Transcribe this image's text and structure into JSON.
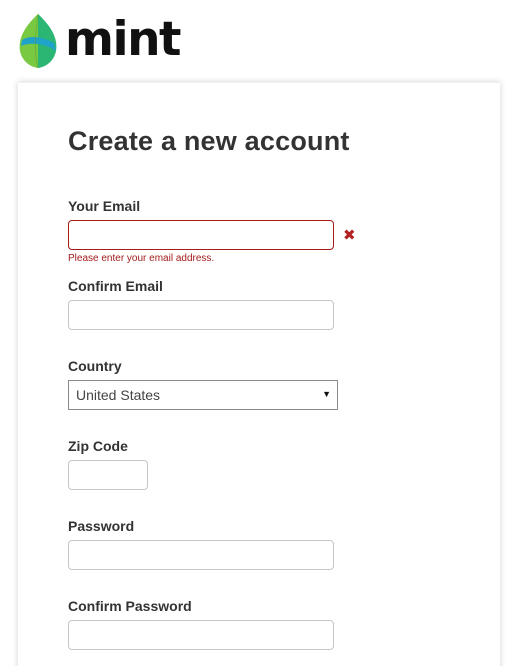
{
  "brand": {
    "logo_text": "mint",
    "leaf_colors": [
      "#7ac943",
      "#2bb673",
      "#1fa3c8"
    ]
  },
  "form": {
    "title": "Create a new account",
    "email": {
      "label": "Your Email",
      "value": "",
      "error_message": "Please enter your email address.",
      "error_icon": "✖"
    },
    "confirm_email": {
      "label": "Confirm Email",
      "value": ""
    },
    "country": {
      "label": "Country",
      "selected": "United States",
      "arrow": "▼"
    },
    "zip": {
      "label": "Zip Code",
      "value": ""
    },
    "password": {
      "label": "Password",
      "value": ""
    },
    "confirm_password": {
      "label": "Confirm Password",
      "value": ""
    }
  },
  "colors": {
    "error": "#a51b1b",
    "text": "#333333"
  }
}
